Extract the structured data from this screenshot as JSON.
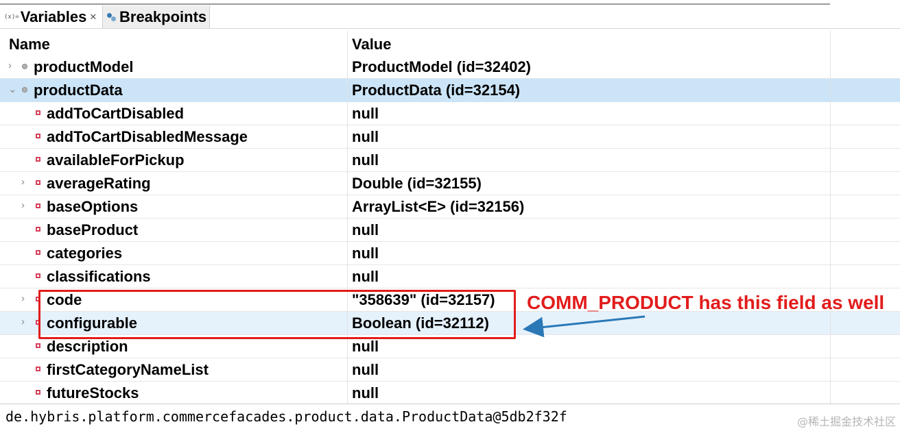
{
  "tabs": {
    "variables_icon": "(x)=",
    "variables_label": "Variables",
    "variables_close": "✕",
    "breakpoints_label": "Breakpoints"
  },
  "columns": {
    "name": "Name",
    "value": "Value"
  },
  "rows": [
    {
      "name": "productModel",
      "value": "ProductModel  (id=32402)",
      "level": 0,
      "expander": "›",
      "icon": "object"
    },
    {
      "name": "productData",
      "value": "ProductData  (id=32154)",
      "level": 0,
      "expander": "⌄",
      "icon": "object",
      "selected": true
    },
    {
      "name": "addToCartDisabled",
      "value": "null",
      "level": 1,
      "expander": "",
      "icon": "field"
    },
    {
      "name": "addToCartDisabledMessage",
      "value": "null",
      "level": 1,
      "expander": "",
      "icon": "field"
    },
    {
      "name": "availableForPickup",
      "value": "null",
      "level": 1,
      "expander": "",
      "icon": "field"
    },
    {
      "name": "averageRating",
      "value": "Double  (id=32155)",
      "level": 1,
      "expander": "›",
      "icon": "field"
    },
    {
      "name": "baseOptions",
      "value": "ArrayList<E>  (id=32156)",
      "level": 1,
      "expander": "›",
      "icon": "field"
    },
    {
      "name": "baseProduct",
      "value": "null",
      "level": 1,
      "expander": "",
      "icon": "field"
    },
    {
      "name": "categories",
      "value": "null",
      "level": 1,
      "expander": "",
      "icon": "field"
    },
    {
      "name": "classifications",
      "value": "null",
      "level": 1,
      "expander": "",
      "icon": "field"
    },
    {
      "name": "code",
      "value": "\"358639\" (id=32157)",
      "level": 1,
      "expander": "›",
      "icon": "field"
    },
    {
      "name": "configurable",
      "value": "Boolean  (id=32112)",
      "level": 1,
      "expander": "›",
      "icon": "field",
      "hover": true
    },
    {
      "name": "description",
      "value": "null",
      "level": 1,
      "expander": "",
      "icon": "field"
    },
    {
      "name": "firstCategoryNameList",
      "value": "null",
      "level": 1,
      "expander": "",
      "icon": "field"
    },
    {
      "name": "futureStocks",
      "value": "null",
      "level": 1,
      "expander": "",
      "icon": "field"
    }
  ],
  "detail": {
    "text": "de.hybris.platform.commercefacades.product.data.ProductData@5db2f32f",
    "watermark": "@稀土掘金技术社区"
  },
  "annotation": {
    "text": "COMM_PRODUCT has this field as well",
    "color": "#e21c1c",
    "arrow_color": "#2a78b6"
  }
}
